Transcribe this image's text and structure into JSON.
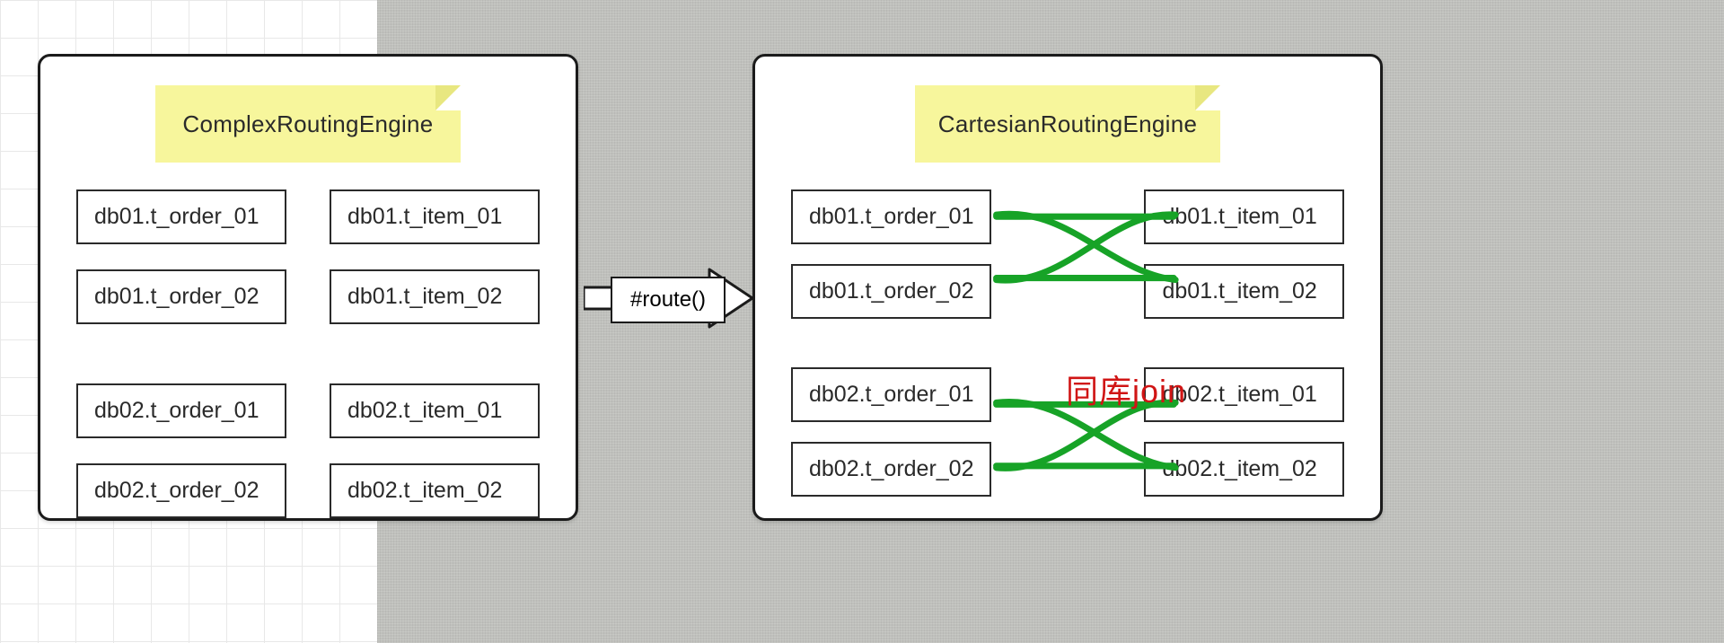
{
  "left": {
    "title": "ComplexRoutingEngine",
    "orders": [
      "db01.t_order_01",
      "db01.t_order_02",
      "db02.t_order_01",
      "db02.t_order_02"
    ],
    "items": [
      "db01.t_item_01",
      "db01.t_item_02",
      "db02.t_item_01",
      "db02.t_item_02"
    ]
  },
  "arrow": {
    "label": "#route()"
  },
  "right": {
    "title": "CartesianRoutingEngine",
    "orders": [
      "db01.t_order_01",
      "db01.t_order_02",
      "db02.t_order_01",
      "db02.t_order_02"
    ],
    "items": [
      "db01.t_item_01",
      "db01.t_item_02",
      "db02.t_item_01",
      "db02.t_item_02"
    ],
    "annotation": "同库join",
    "join_stroke": "#17a327"
  }
}
